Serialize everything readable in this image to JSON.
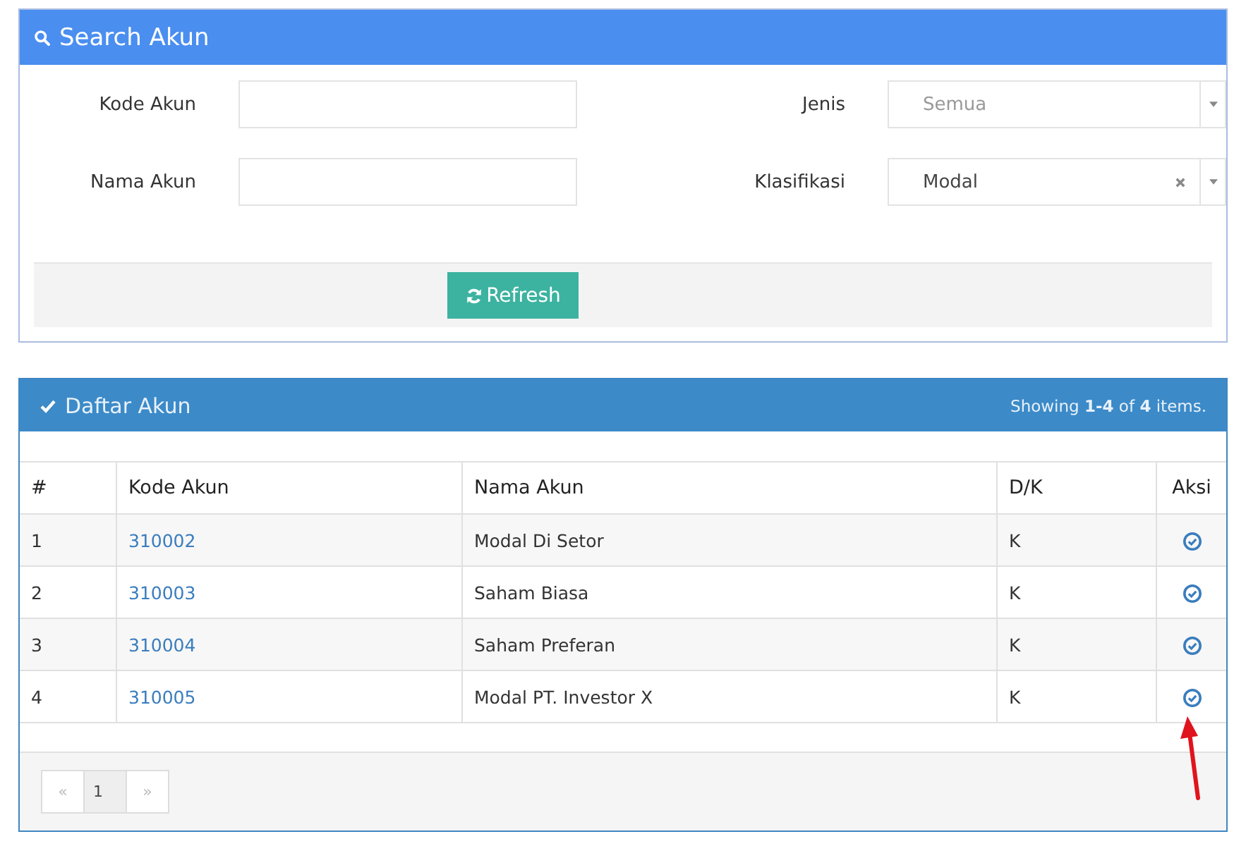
{
  "search_panel": {
    "title": "Search Akun",
    "fields": [
      {
        "label": "Kode Akun",
        "kind": "text"
      },
      {
        "label": "Jenis",
        "kind": "select",
        "placeholder": "Semua",
        "clearable": false
      },
      {
        "label": "Nama Akun",
        "kind": "text"
      },
      {
        "label": "Klasifikasi",
        "kind": "select",
        "value": "Modal",
        "clearable": true
      }
    ],
    "button": "Refresh"
  },
  "list_panel": {
    "title": "Daftar Akun",
    "summary": "Showing **1-4** of **4** items.",
    "columns": [
      "#",
      "Kode Akun",
      "Nama Akun",
      "D/K",
      "Aksi"
    ],
    "rows": [
      {
        "no": "1",
        "kode": "310002",
        "nama": "Modal Di Setor",
        "dk": "K"
      },
      {
        "no": "2",
        "kode": "310003",
        "nama": "Saham Biasa",
        "dk": "K"
      },
      {
        "no": "3",
        "kode": "310004",
        "nama": "Saham Preferan",
        "dk": "K"
      },
      {
        "no": "4",
        "kode": "310005",
        "nama": "Modal PT. Investor X",
        "dk": "K"
      }
    ],
    "pagination": [
      {
        "label": "«",
        "disabled": true,
        "selected": false
      },
      {
        "label": "1",
        "disabled": false,
        "selected": true
      },
      {
        "label": "»",
        "disabled": true,
        "selected": false
      }
    ]
  },
  "annotation": {
    "kind": "arrow"
  }
}
